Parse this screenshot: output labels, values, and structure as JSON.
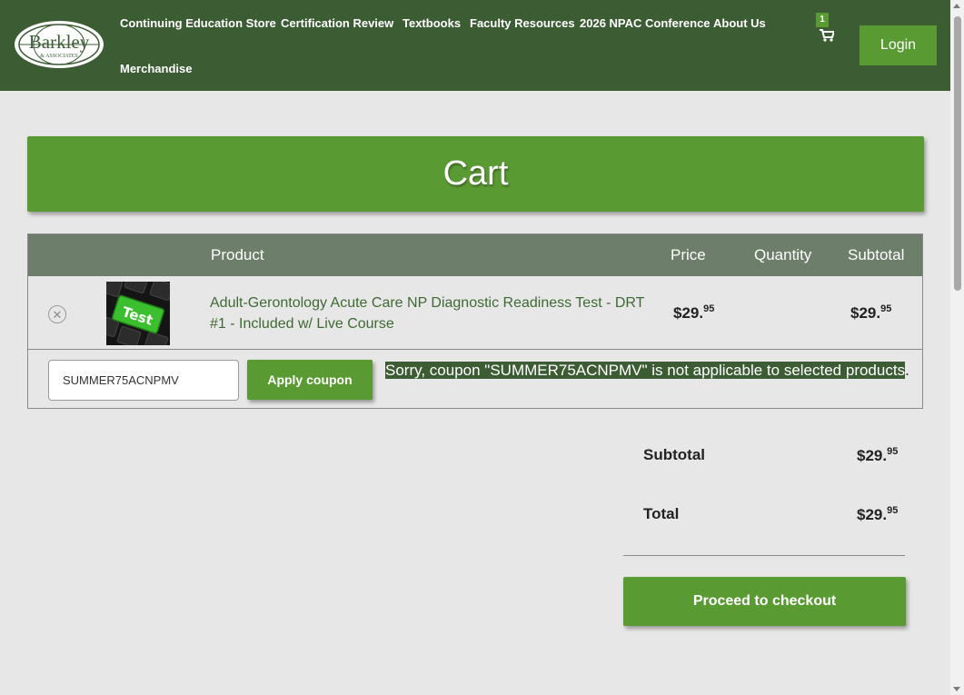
{
  "header": {
    "logo_text": "Barkley",
    "logo_subtext": "& ASSOCIATES",
    "nav_items": [
      "Continuing Education Store",
      "Certification Review",
      "Textbooks",
      "Faculty Resources",
      "2026 NPAC Conference",
      "About Us",
      "Merchandise"
    ],
    "cart_count": "1",
    "login_label": "Login"
  },
  "page": {
    "title": "Cart"
  },
  "table": {
    "headers": {
      "product": "Product",
      "price": "Price",
      "quantity": "Quantity",
      "subtotal": "Subtotal"
    },
    "items": [
      {
        "remove": "✕",
        "thumbnail_text": "Test",
        "name": "Adult-Gerontology Acute Care NP Diagnostic Readiness Test - DRT #1 - Included w/ Live Course",
        "price_main": "$29.",
        "price_cents": "95",
        "subtotal_main": "$29.",
        "subtotal_cents": "95"
      }
    ]
  },
  "coupon": {
    "value": "SUMMER75ACNPMV",
    "apply_label": "Apply coupon",
    "message": "Sorry, coupon \"SUMMER75ACNPMV\" is not applicable to selected products",
    "message_end": "."
  },
  "totals": {
    "subtotal_label": "Subtotal",
    "subtotal_main": "$29.",
    "subtotal_cents": "95",
    "total_label": "Total",
    "total_main": "$29.",
    "total_cents": "95",
    "checkout_label": "Proceed to checkout"
  },
  "colors": {
    "header_bg": "#3c5c34",
    "accent_green": "#5a9a32",
    "table_header_bg": "#6d7f6a",
    "page_bg": "#e7e7e7"
  }
}
